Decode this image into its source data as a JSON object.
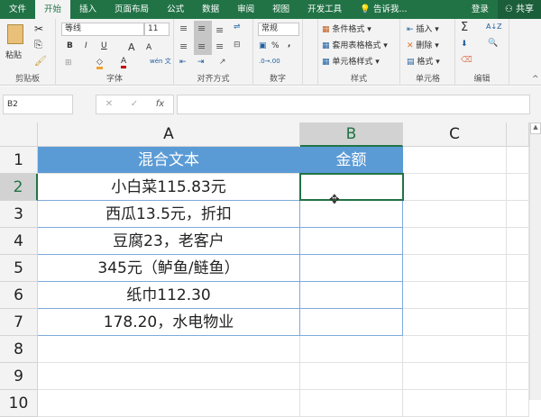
{
  "tabs": [
    "文件",
    "开始",
    "插入",
    "页面布局",
    "公式",
    "数据",
    "审阅",
    "视图",
    "开发工具"
  ],
  "tell_me": "告诉我...",
  "login": "登录",
  "share": "共享",
  "ribbon": {
    "clipboard": {
      "label": "剪贴板",
      "paste": "粘贴"
    },
    "font": {
      "label": "字体",
      "name": "等线",
      "size": "11",
      "bold": "B",
      "italic": "I",
      "underline": "U",
      "wen": "wén 文"
    },
    "alignment": {
      "label": "对齐方式"
    },
    "number": {
      "label": "数字",
      "format": "常规",
      "percent": "%",
      "comma": ","
    },
    "styles": {
      "label": "样式",
      "items": [
        "条件格式",
        "套用表格格式",
        "单元格样式"
      ]
    },
    "cells": {
      "label": "单元格",
      "items": [
        "插入",
        "删除",
        "格式"
      ]
    },
    "editing": {
      "label": "编辑",
      "sum": "Σ",
      "sort": "A↓Z"
    }
  },
  "formula_bar": {
    "name_box": "B2",
    "cancel": "✕",
    "enter": "✓",
    "fx": "fx",
    "value": ""
  },
  "columns": [
    "A",
    "B",
    "C"
  ],
  "rows": [
    "1",
    "2",
    "3",
    "4",
    "5",
    "6",
    "7",
    "8",
    "9",
    "10"
  ],
  "sheet": {
    "header": [
      "混合文本",
      "金额"
    ],
    "data": [
      [
        "小白菜115.83元",
        ""
      ],
      [
        "西瓜13.5元，折扣",
        ""
      ],
      [
        "豆腐23，老客户",
        ""
      ],
      [
        "345元（鲈鱼/鲢鱼）",
        ""
      ],
      [
        "纸巾112.30",
        ""
      ],
      [
        "178.20，水电物业",
        ""
      ]
    ]
  },
  "colors": {
    "green": "#217346",
    "header_blue": "#5b9bd5"
  }
}
